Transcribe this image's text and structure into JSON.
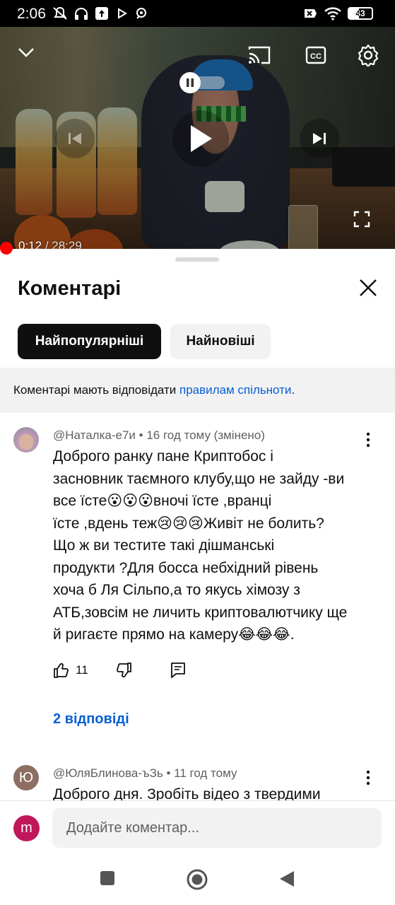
{
  "status_bar": {
    "time": "2:06",
    "battery": "43"
  },
  "video": {
    "current_time": "0:12",
    "separator": " / ",
    "duration": "28:29",
    "progress_fraction": 0.007,
    "icons": [
      "chevron-down-icon",
      "autoplay-toggle-icon",
      "cast-icon",
      "captions-icon",
      "settings-icon",
      "previous-icon",
      "play-icon",
      "next-icon",
      "fullscreen-icon"
    ]
  },
  "sheet": {
    "title": "Коментарі",
    "tabs": [
      {
        "label": "Найпопулярніші",
        "active": true
      },
      {
        "label": "Найновіші",
        "active": false
      }
    ],
    "rules_text": "Коментарі мають відповідати ",
    "rules_link": "правилам спільноти",
    "rules_end": "."
  },
  "comments": [
    {
      "author": "@Наталка-е7и",
      "time": "16 год тому (змінено)",
      "lines": [
        "Доброго ранку пане Криптобос і",
        "засновник таємного клубу,що не зайду -ви",
        "все їсте😮😮😮вночі їсте ,вранці",
        "їсте ,вдень теж😢😢😢Живіт не болить?",
        "Що ж ви тестите такі дішманські",
        "продукти ?Для босса небхідний рівень",
        "хоча б Ля Сільпо,а то якусь хімозу з",
        "АТБ,зовсім не личить криптовалютчику ще",
        "й ригаєте прямо на камеру😂😂😂."
      ],
      "likes": "11",
      "replies": "2 відповіді"
    },
    {
      "author": "@ЮляБлинова-ъЗь",
      "time": "11 год тому",
      "avatar_letter": "Ю",
      "lines": [
        "Доброго дня. Зробіть відео з твердими"
      ]
    }
  ],
  "composer": {
    "avatar_letter": "m",
    "placeholder": "Додайте коментар..."
  },
  "colors": {
    "link": "#065fd4",
    "progress": "#ff0000",
    "composer_avatar": "#c0175b",
    "second_avatar": "#8d6e63"
  }
}
